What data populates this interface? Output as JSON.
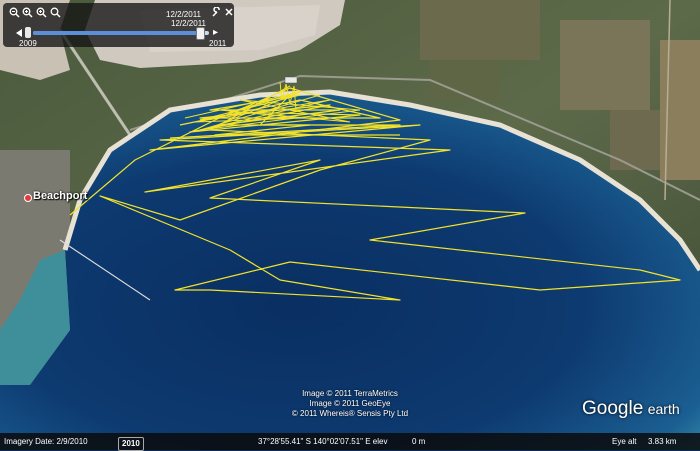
{
  "slider": {
    "date_top": "12/2/2011",
    "date_bottom": "12/2/2011",
    "year_start": "2009",
    "year_end": "2011",
    "position": 0.95
  },
  "map": {
    "place_label": "Beachport",
    "attribution": [
      "Image © 2011 TerraMetrics",
      "Image © 2011 GeoEye",
      "© 2011 Whereis® Sensis Pty Ltd"
    ],
    "logo_google": "Google",
    "logo_earth": "earth",
    "track_color": "#f2e22a",
    "water_colors": [
      "#0a2f62",
      "#1b5f92",
      "#3f9fb6"
    ]
  },
  "status": {
    "imagery_date": "Imagery Date: 2/9/2010",
    "year_badge": "2010",
    "coordinates": "37°28'55.41\" S 140°02'07.51\" E elev",
    "elevation": "0 m",
    "eye_alt_label": "Eye alt",
    "eye_alt_value": "3.83 km"
  },
  "icons": [
    "zoom-out-icon",
    "zoom-in-icon",
    "magnifier-icon",
    "settings-icon",
    "close-icon"
  ]
}
